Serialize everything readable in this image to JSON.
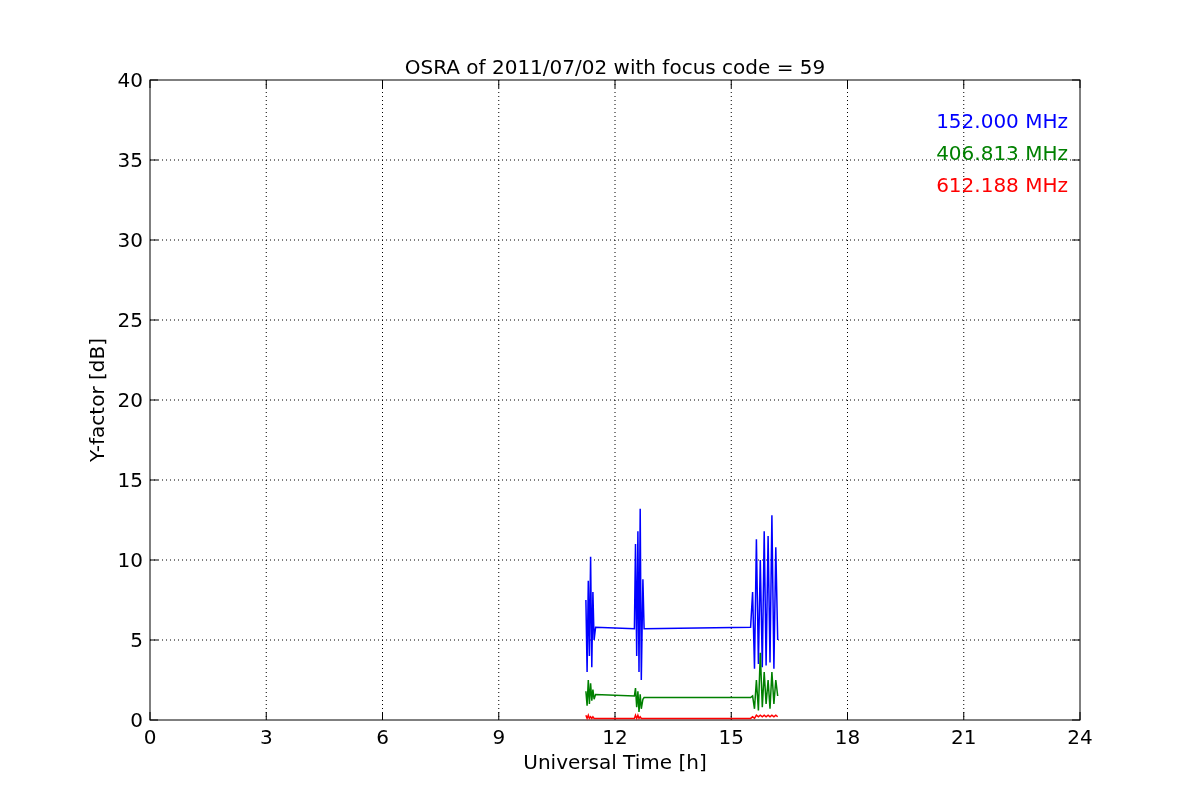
{
  "figure": {
    "chart_data": {
      "type": "line",
      "title": "OSRA of 2011/07/02 with focus code = 59",
      "xlabel": "Universal Time [h]",
      "ylabel": "Y-factor [dB]",
      "xlim": [
        0,
        24
      ],
      "ylim": [
        0,
        40
      ],
      "xticks": [
        0,
        3,
        6,
        9,
        12,
        15,
        18,
        21,
        24
      ],
      "yticks": [
        0,
        5,
        10,
        15,
        20,
        25,
        30,
        35,
        40
      ],
      "grid": true,
      "x": [
        11.25,
        11.28,
        11.31,
        11.34,
        11.37,
        11.4,
        11.43,
        11.46,
        11.5,
        12.5,
        12.53,
        12.56,
        12.59,
        12.62,
        12.65,
        12.68,
        12.72,
        12.75,
        15.5,
        15.55,
        15.6,
        15.65,
        15.7,
        15.75,
        15.8,
        15.85,
        15.9,
        15.95,
        16.0,
        16.05,
        16.1,
        16.15,
        16.2
      ],
      "series": [
        {
          "name": "152.000 MHz",
          "color": "#0000ff",
          "values": [
            7.5,
            3,
            8.7,
            4,
            10.2,
            3.3,
            8,
            5,
            5.8,
            5.7,
            11,
            4,
            11.8,
            3,
            13.2,
            2.5,
            8.8,
            5.7,
            5.8,
            8,
            3.2,
            11.3,
            3.5,
            10,
            3.3,
            11.8,
            3.4,
            11.5,
            3.6,
            12.8,
            3.2,
            10.8,
            5
          ]
        },
        {
          "name": "406.813 MHz",
          "color": "#008000",
          "values": [
            1.8,
            0.9,
            2.5,
            1,
            2.3,
            1.2,
            1.9,
            1.3,
            1.6,
            1.5,
            2,
            0.8,
            1.8,
            0.5,
            1.6,
            0.7,
            1.3,
            1.4,
            1.4,
            1.5,
            0.7,
            2.5,
            0.6,
            4.2,
            0.8,
            3,
            1,
            2.5,
            0.7,
            3,
            1,
            2.5,
            1.5
          ]
        },
        {
          "name": "612.188 MHz",
          "color": "#ff0000",
          "values": [
            0.3,
            0.1,
            0.3,
            0.1,
            0.2,
            0.1,
            0.2,
            0.1,
            0.1,
            0.1,
            0.3,
            0.1,
            0.3,
            0.1,
            0.2,
            0.1,
            0.1,
            0.1,
            0.1,
            0.2,
            0.1,
            0.3,
            0.2,
            0.3,
            0.2,
            0.3,
            0.2,
            0.3,
            0.2,
            0.3,
            0.2,
            0.3,
            0.2
          ]
        }
      ]
    }
  }
}
